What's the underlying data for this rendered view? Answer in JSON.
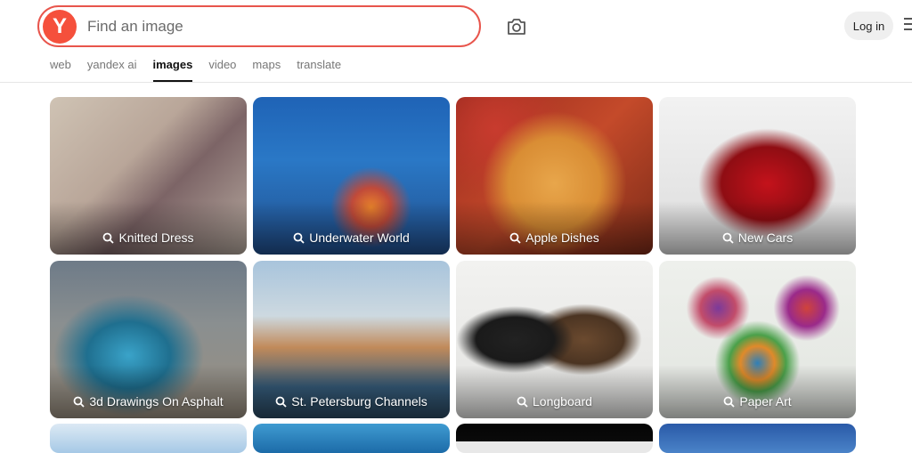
{
  "header": {
    "logo_letter": "Y",
    "search_placeholder": "Find an image",
    "login_label": "Log in"
  },
  "tabs": [
    {
      "label": "web",
      "active": false
    },
    {
      "label": "yandex ai",
      "active": false
    },
    {
      "label": "images",
      "active": true
    },
    {
      "label": "video",
      "active": false
    },
    {
      "label": "maps",
      "active": false
    },
    {
      "label": "translate",
      "active": false
    }
  ],
  "cards": [
    {
      "caption": "Knitted Dress"
    },
    {
      "caption": "Underwater World"
    },
    {
      "caption": "Apple Dishes"
    },
    {
      "caption": "New Cars"
    },
    {
      "caption": "3d Drawings On Asphalt"
    },
    {
      "caption": "St. Petersburg Channels"
    },
    {
      "caption": "Longboard"
    },
    {
      "caption": "Paper Art"
    }
  ],
  "colors": {
    "accent": "#f5503c",
    "search_border": "#e8554c",
    "login_bg": "#efefef"
  },
  "icons": [
    "search-icon",
    "camera-icon",
    "menu-icon"
  ]
}
